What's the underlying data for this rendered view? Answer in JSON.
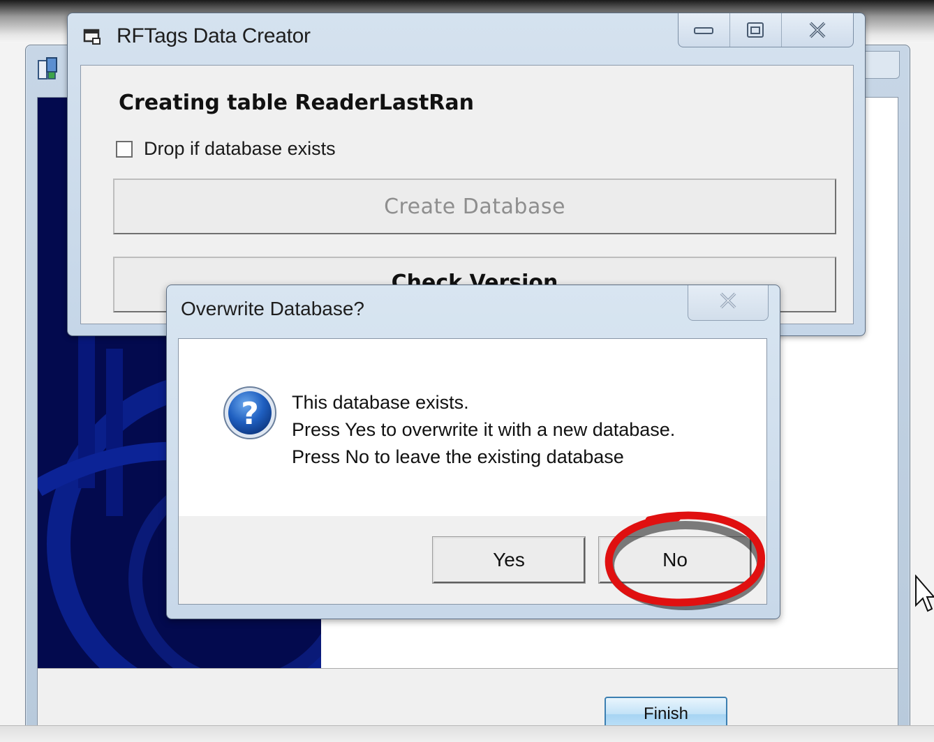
{
  "wizard": {
    "finish_label": "Finish"
  },
  "creator": {
    "title": "RFTags Data Creator",
    "heading": "Creating table ReaderLastRan",
    "drop_checkbox_label": "Drop if database exists",
    "drop_checked": false,
    "create_button_label": "Create Database",
    "create_button_enabled": false,
    "check_version_label": "Check Version"
  },
  "dialog": {
    "title": "Overwrite Database?",
    "message_lines": [
      "This database exists.",
      "Press Yes to overwrite it with a new database.",
      "Press No to leave the existing database"
    ],
    "yes_label": "Yes",
    "no_label": "No"
  },
  "icons": {
    "window_controls": [
      "minimize-icon",
      "maximize-icon",
      "close-icon"
    ],
    "dialog_icon": "question-icon"
  },
  "colors": {
    "annotation": "#e01010",
    "banner": "#030a4e",
    "finish_border": "#3c7fb1"
  }
}
